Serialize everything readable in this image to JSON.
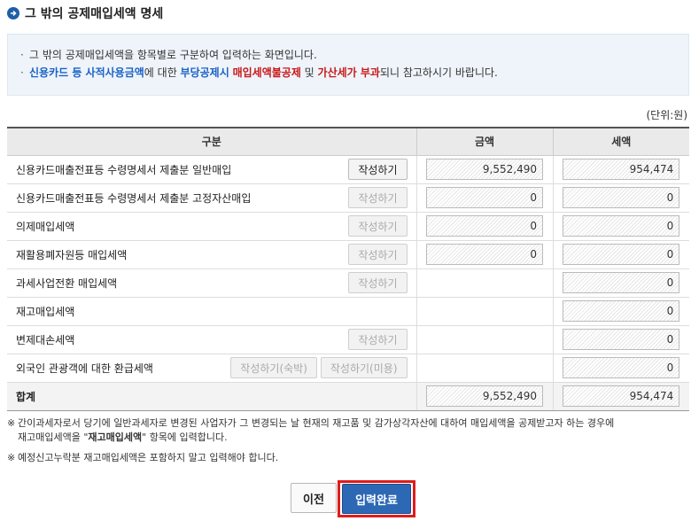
{
  "title": "그 밖의 공제매입세액 명세",
  "info": {
    "line1": "그 밖의 공제매입세액을 항목별로 구분하여 입력하는 화면입니다.",
    "line2_part1": "신용카드 등 사적사용금액",
    "line2_part2": "에 대한 ",
    "line2_part3": "부당공제시",
    "line2_part4": " ",
    "line2_part5": "매입세액불공제",
    "line2_part6": " 및 ",
    "line2_part7": "가산세가 부과",
    "line2_part8": "되니 참고하시기 바랍니다."
  },
  "unit": "(단위:원)",
  "table": {
    "headers": {
      "category": "구분",
      "amount": "금액",
      "tax": "세액"
    },
    "rows": [
      {
        "label": "신용카드매출전표등 수령명세서 제출분 일반매입",
        "buttons": [
          {
            "label": "작성하기",
            "enabled": true
          }
        ],
        "amount": "9,552,490",
        "tax": "954,474"
      },
      {
        "label": "신용카드매출전표등 수령명세서 제출분 고정자산매입",
        "buttons": [
          {
            "label": "작성하기",
            "enabled": false
          }
        ],
        "amount": "0",
        "tax": "0"
      },
      {
        "label": "의제매입세액",
        "buttons": [
          {
            "label": "작성하기",
            "enabled": false
          }
        ],
        "amount": "0",
        "tax": "0"
      },
      {
        "label": "재활용폐자원등 매입세액",
        "buttons": [
          {
            "label": "작성하기",
            "enabled": false
          }
        ],
        "amount": "0",
        "tax": "0"
      },
      {
        "label": "과세사업전환 매입세액",
        "buttons": [
          {
            "label": "작성하기",
            "enabled": false
          }
        ],
        "amount": null,
        "tax": "0"
      },
      {
        "label": "재고매입세액",
        "buttons": [],
        "amount": null,
        "tax": "0"
      },
      {
        "label": "변제대손세액",
        "buttons": [
          {
            "label": "작성하기",
            "enabled": false
          }
        ],
        "amount": null,
        "tax": "0"
      },
      {
        "label": "외국인 관광객에 대한 환급세액",
        "buttons": [
          {
            "label": "작성하기(숙박)",
            "enabled": false
          },
          {
            "label": "작성하기(미용)",
            "enabled": false
          }
        ],
        "amount": null,
        "tax": "0"
      }
    ],
    "total": {
      "label": "합계",
      "amount": "9,552,490",
      "tax": "954,474"
    }
  },
  "notes": {
    "mark": "※",
    "note1_a": "간이과세자로서 당기에 일반과세자로 변경된 사업자가 그 변경되는 날 현재의 재고품 및 감가상각자산에 대하여 매입세액을 공제받고자 하는 경우에",
    "note1_b1": "재고매입세액을 \"",
    "note1_b2": "재고매입세액",
    "note1_b3": "\" 항목에 입력합니다.",
    "note2": "예정신고누락분 재고매입세액은 포함하지 말고 입력해야 합니다."
  },
  "actions": {
    "prev_label": "이전",
    "submit_label": "입력완료"
  },
  "colors": {
    "accent_blue": "#1b62c6",
    "warn_red": "#c81818",
    "highlight": "#e11b1b",
    "submit_bg": "#2d68b4"
  }
}
